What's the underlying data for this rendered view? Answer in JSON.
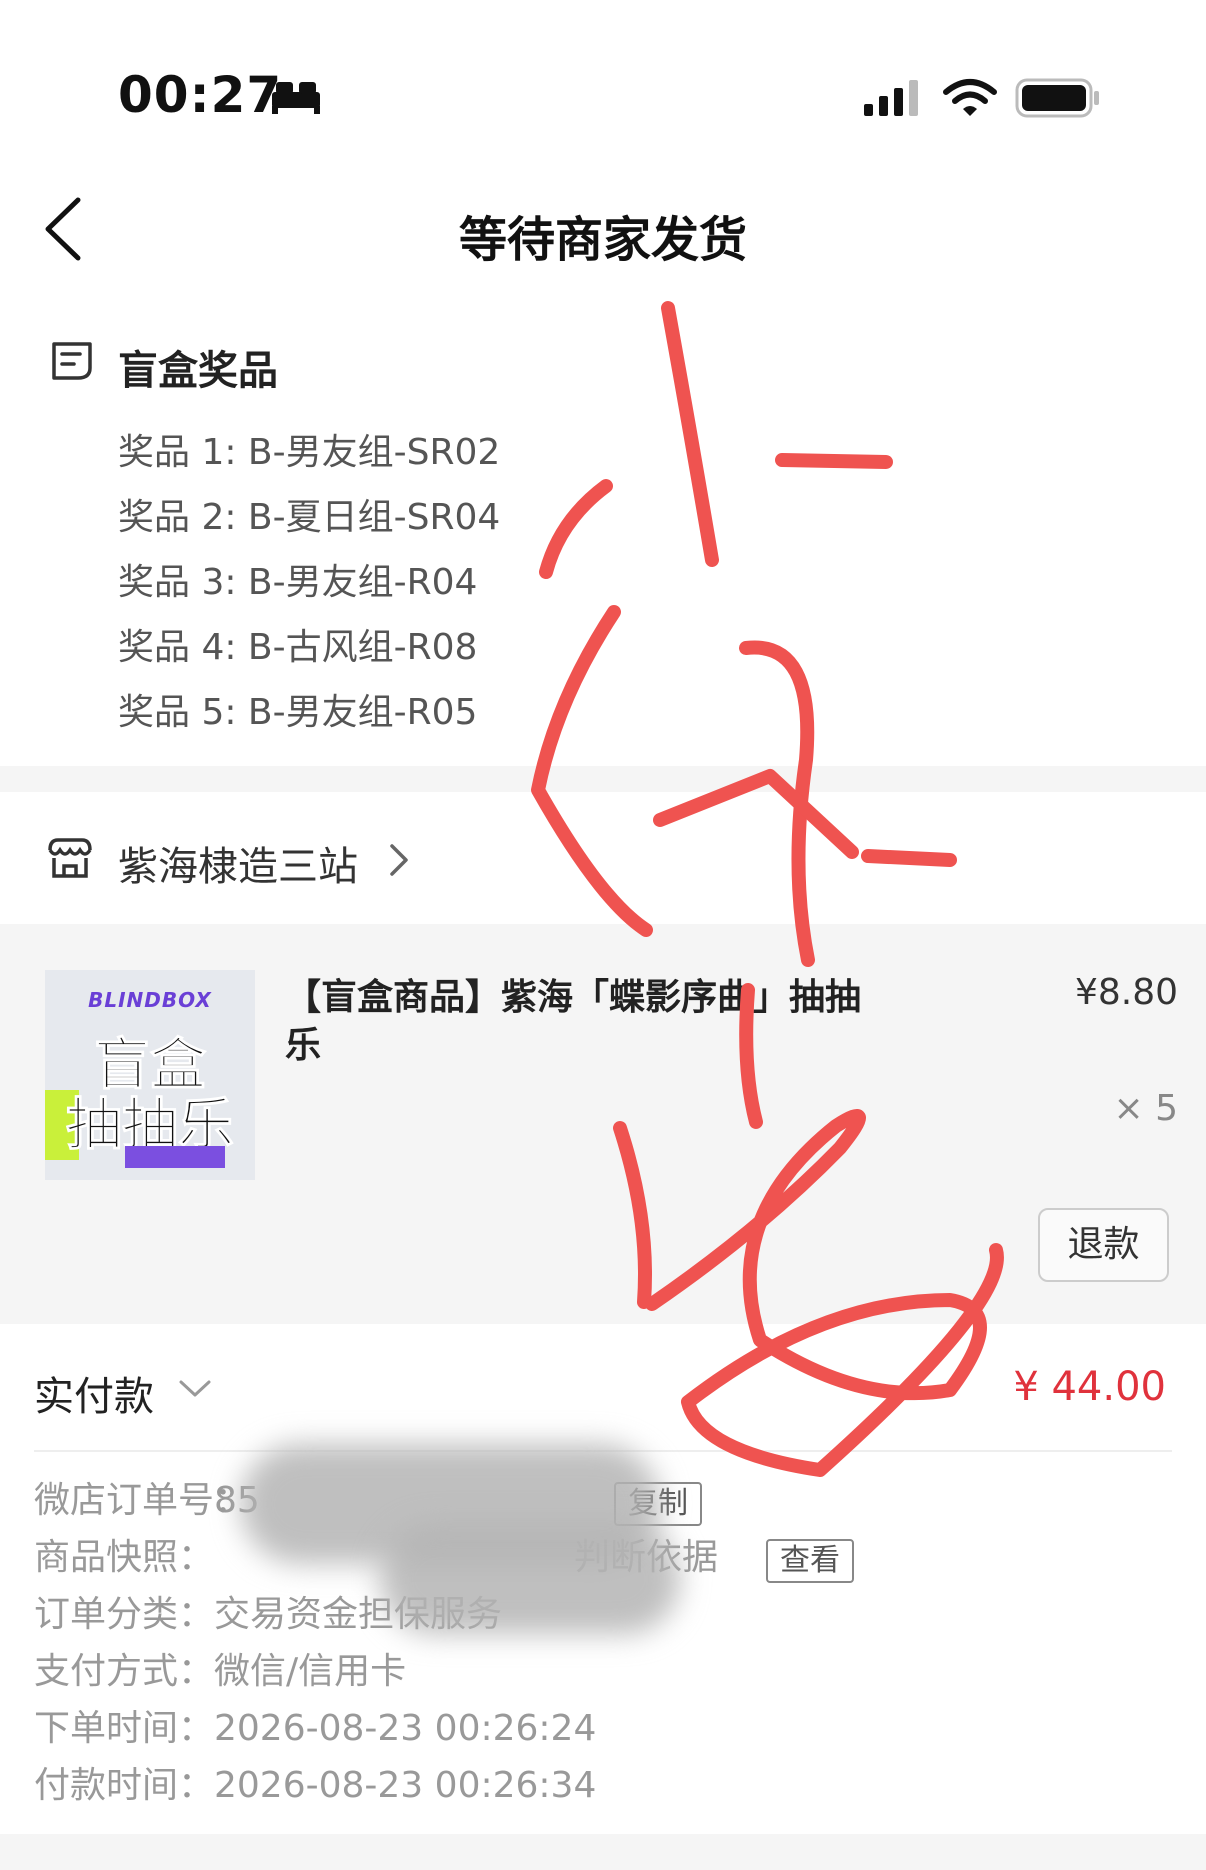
{
  "status_bar": {
    "time": "00:27"
  },
  "nav": {
    "title": "等待商家发货"
  },
  "prizes": {
    "heading": "盲盒奖品",
    "items": [
      "奖品 1: B-男友组-SR02",
      "奖品 2: B-夏日组-SR04",
      "奖品 3: B-男友组-R04",
      "奖品 4: B-古风组-R08",
      "奖品 5: B-男友组-R05"
    ]
  },
  "shop": {
    "name": "紫海棣造三站"
  },
  "product": {
    "thumb_tag": "BLINDBOX",
    "thumb_line1": "盲盒",
    "thumb_line2": "抽抽乐",
    "title": "【盲盒商品】紫海「蝶影序曲」抽抽乐",
    "price": "¥8.80",
    "quantity": "× 5",
    "refund_label": "退款"
  },
  "payment": {
    "label": "实付款",
    "amount": "¥ 44.00",
    "rows": [
      {
        "key": "微店订单号：",
        "value": "85",
        "action": "复制"
      },
      {
        "key": "商品快照：",
        "value": "判断依据",
        "action": "查看"
      },
      {
        "key": "订单分类：",
        "value": "交易资金担保服务"
      },
      {
        "key": "支付方式：",
        "value": "微信/信用卡"
      },
      {
        "key": "下单时间：",
        "value": "2026-08-23 00:26:24"
      },
      {
        "key": "付款时间：",
        "value": "2026-08-23 00:26:34"
      }
    ]
  },
  "annotation": {
    "color": "#ef5350",
    "description": "handwritten red marks"
  },
  "colors": {
    "accent_red": "#e0323c",
    "page_gray": "#f5f5f5"
  }
}
